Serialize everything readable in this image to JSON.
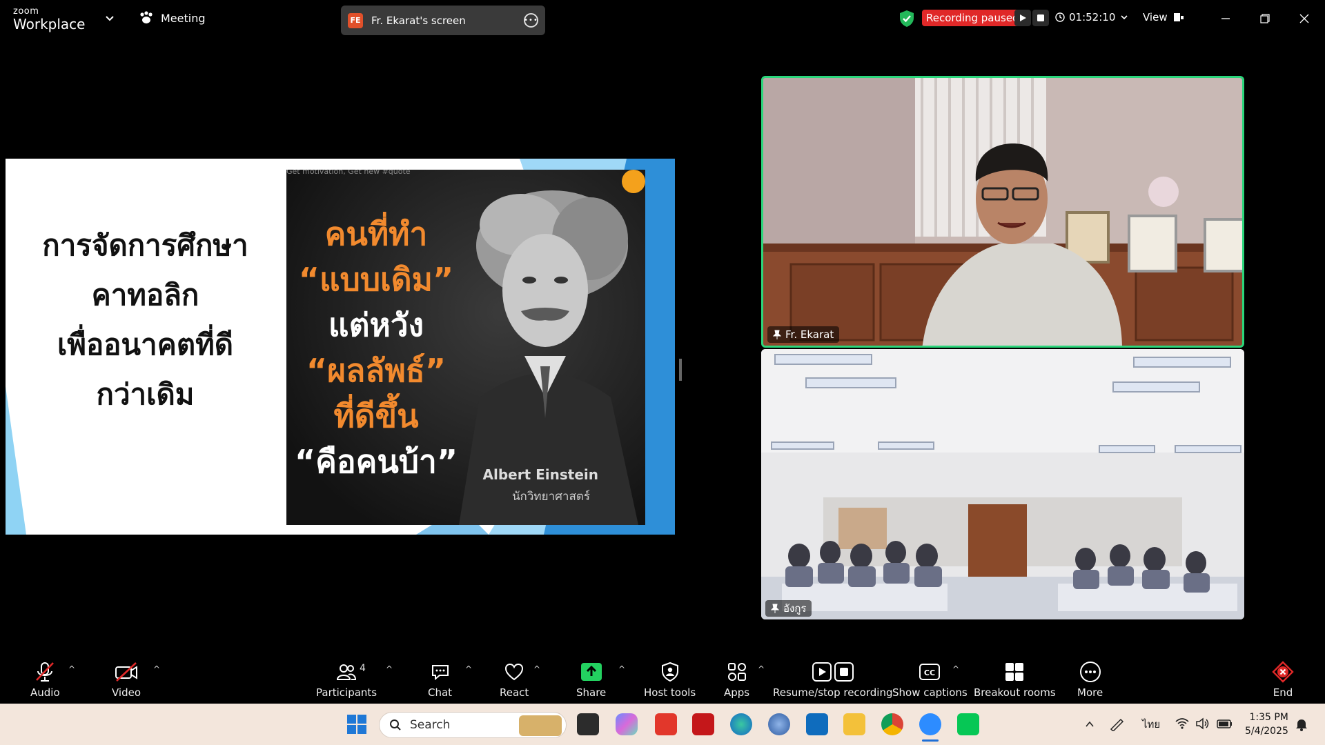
{
  "app": {
    "logo_small": "zoom",
    "logo_big": "Workplace",
    "meeting_label": "Meeting"
  },
  "screen_share": {
    "initials": "FE",
    "label": "Fr. Ekarat's screen"
  },
  "recording": {
    "status": "Recording paused",
    "timer": "01:52:10"
  },
  "view_label": "View",
  "slide": {
    "title_lines": [
      "การจัดการศึกษา",
      "คาทอลิก",
      "เพื่ออนาคตที่ดี",
      "กว่าเดิม"
    ],
    "poster_motto": "Get motivation, Get new #quote",
    "quote_lines": [
      "คนที่ทำ",
      "“แบบเดิม”",
      "แต่หวัง",
      "“ผลลัพธ์”",
      "ที่ดีขึ้น",
      "“คือคนบ้า”"
    ],
    "author": "Albert Einstein",
    "author_role": "นักวิทยาศาสตร์"
  },
  "tiles": [
    {
      "name": "Fr. Ekarat",
      "active": true
    },
    {
      "name": "อังกูร",
      "active": false
    }
  ],
  "toolbar": {
    "audio": "Audio",
    "video": "Video",
    "participants": "Participants",
    "participants_count": "4",
    "chat": "Chat",
    "react": "React",
    "share": "Share",
    "host_tools": "Host tools",
    "apps": "Apps",
    "recording": "Resume/stop recording",
    "captions": "Show captions",
    "breakout": "Breakout rooms",
    "more": "More",
    "end": "End"
  },
  "taskbar": {
    "search_placeholder": "Search",
    "lang": "ไทย",
    "time": "1:35 PM",
    "date": "5/4/2025"
  },
  "colors": {
    "accent_green": "#2bd67b",
    "record_red": "#e02828",
    "share_green": "#23d160",
    "quote_orange": "#f28a2e"
  }
}
